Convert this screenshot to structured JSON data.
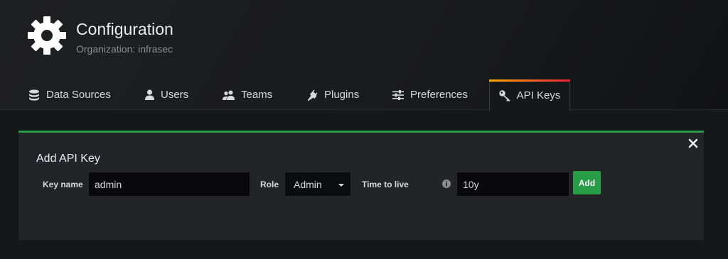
{
  "header": {
    "title": "Configuration",
    "subtitle": "Organization: infrasec",
    "icon": "gear-icon"
  },
  "tabs": [
    {
      "label": "Data Sources",
      "icon": "database-icon",
      "active": false
    },
    {
      "label": "Users",
      "icon": "user-icon",
      "active": false
    },
    {
      "label": "Teams",
      "icon": "users-icon",
      "active": false
    },
    {
      "label": "Plugins",
      "icon": "plug-icon",
      "active": false
    },
    {
      "label": "Preferences",
      "icon": "sliders-icon",
      "active": false
    },
    {
      "label": "API Keys",
      "icon": "key-icon",
      "active": true
    }
  ],
  "form": {
    "title": "Add API Key",
    "key_name_label": "Key name",
    "key_name_value": "admin",
    "role_label": "Role",
    "role_value": "Admin",
    "ttl_label": "Time to live",
    "ttl_value": "10y",
    "add_label": "Add"
  },
  "colors": {
    "accent_green": "#299c46",
    "background": "#161719",
    "panel": "#232427"
  }
}
